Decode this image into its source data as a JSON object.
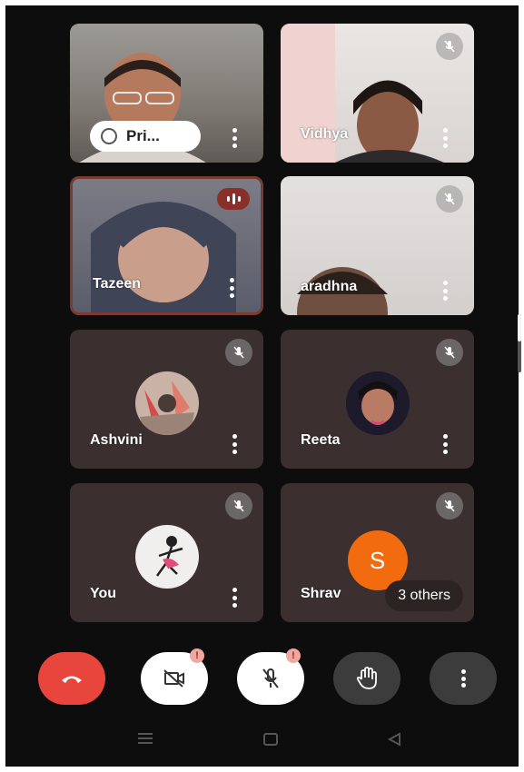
{
  "participants": [
    {
      "name": "Pri...",
      "type": "video",
      "pinned_pill": true
    },
    {
      "name": "Vidhya",
      "type": "video",
      "muted": true
    },
    {
      "name": "Tazeen",
      "type": "video",
      "speaking": true
    },
    {
      "name": "Aradhna",
      "display_label": "aradhna",
      "type": "video",
      "muted": true
    },
    {
      "name": "Ashvini",
      "type": "avatar",
      "muted": true
    },
    {
      "name": "Reeta",
      "type": "avatar",
      "muted": true
    },
    {
      "name": "You",
      "type": "avatar",
      "muted": true
    },
    {
      "name": "Shravani",
      "display_label": "Shrav",
      "type": "initial",
      "initial": "S",
      "muted": true,
      "others_label": "3 others"
    }
  ],
  "controls": {
    "end_call": "end-call-icon",
    "camera": "camera-off-icon",
    "camera_badge": "!",
    "mic": "mic-off-icon",
    "mic_badge": "!",
    "hand": "raise-hand-icon",
    "more": "more-options-icon"
  },
  "colors": {
    "end_call": "#e8453c",
    "tile_bg": "#3b302f",
    "speaking": "#8a2f2a",
    "initial_avatar": "#f26b0f"
  }
}
